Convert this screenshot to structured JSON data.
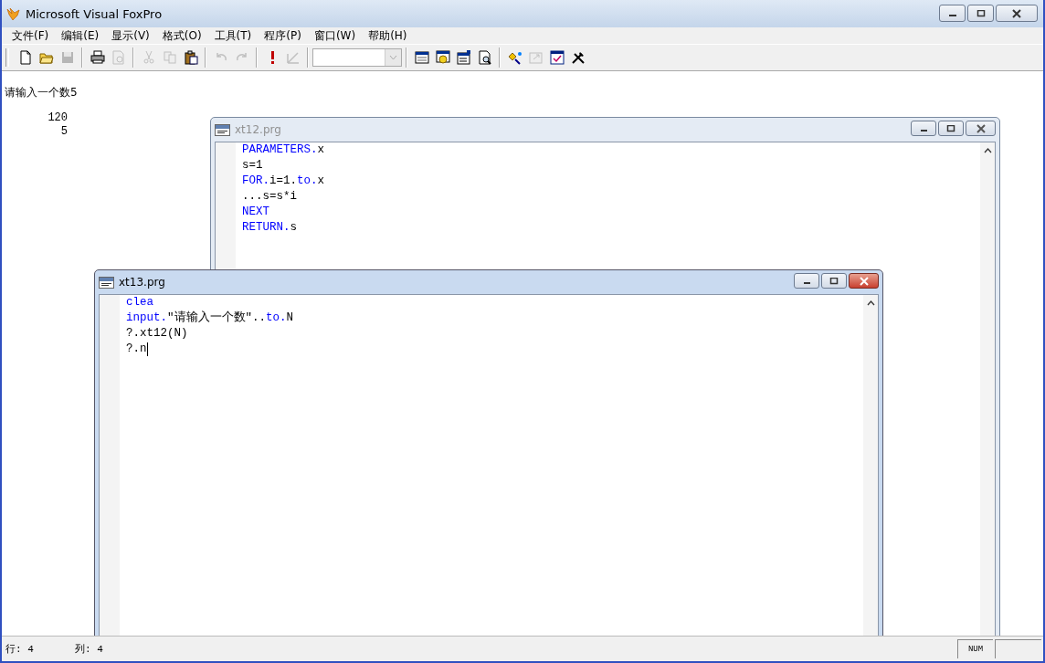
{
  "window": {
    "title": "Microsoft Visual FoxPro"
  },
  "menu": [
    {
      "label": "文件(F)"
    },
    {
      "label": "编辑(E)"
    },
    {
      "label": "显示(V)"
    },
    {
      "label": "格式(O)"
    },
    {
      "label": "工具(T)"
    },
    {
      "label": "程序(P)"
    },
    {
      "label": "窗口(W)"
    },
    {
      "label": "帮助(H)"
    }
  ],
  "toolbar": [
    [
      {
        "kind": "new",
        "disabled": false
      },
      {
        "kind": "open",
        "disabled": false
      },
      {
        "kind": "save",
        "disabled": true
      }
    ],
    [
      {
        "kind": "print",
        "disabled": false
      },
      {
        "kind": "preview",
        "disabled": true
      }
    ],
    [
      {
        "kind": "cut",
        "disabled": true
      },
      {
        "kind": "copy",
        "disabled": true
      },
      {
        "kind": "paste",
        "disabled": false
      }
    ],
    [
      {
        "kind": "undo",
        "disabled": true
      },
      {
        "kind": "redo",
        "disabled": true
      }
    ],
    [
      {
        "kind": "run",
        "disabled": false
      },
      {
        "kind": "modify",
        "disabled": true
      }
    ],
    [
      {
        "kind": "combo",
        "disabled": true
      }
    ],
    [
      {
        "kind": "command",
        "disabled": false
      },
      {
        "kind": "data",
        "disabled": false
      },
      {
        "kind": "properties",
        "disabled": false
      },
      {
        "kind": "find",
        "disabled": false
      }
    ],
    [
      {
        "kind": "wizard",
        "disabled": false
      },
      {
        "kind": "builder",
        "disabled": true
      },
      {
        "kind": "form",
        "disabled": false
      },
      {
        "kind": "tools",
        "disabled": false
      }
    ]
  ],
  "output": [
    {
      "text": "请输入一个数5",
      "kind": "prompt"
    },
    {
      "text": "120",
      "kind": "number"
    },
    {
      "text": "5",
      "kind": "number"
    }
  ],
  "editors": [
    {
      "title": "xt12.prg",
      "active": false,
      "lines": [
        [
          {
            "text": "PARAMETERS.",
            "kind": "keyword"
          },
          {
            "text": "x",
            "kind": "plain"
          }
        ],
        [
          {
            "text": "s=1",
            "kind": "plain"
          }
        ],
        [
          {
            "text": "FOR.",
            "kind": "keyword"
          },
          {
            "text": "i=1.",
            "kind": "plain"
          },
          {
            "text": "to.",
            "kind": "keyword"
          },
          {
            "text": "x",
            "kind": "plain"
          }
        ],
        [
          {
            "text": "...s=s*i",
            "kind": "plain"
          }
        ],
        [
          {
            "text": "NEXT",
            "kind": "keyword"
          }
        ],
        [
          {
            "text": "RETURN.",
            "kind": "keyword"
          },
          {
            "text": "s",
            "kind": "plain"
          }
        ]
      ]
    },
    {
      "title": "xt13.prg",
      "active": true,
      "lines": [
        [
          {
            "text": "clea",
            "kind": "keyword"
          }
        ],
        [
          {
            "text": "input.",
            "kind": "keyword"
          },
          {
            "text": "\"请输入一个数\"..",
            "kind": "plain"
          },
          {
            "text": "to.",
            "kind": "keyword"
          },
          {
            "text": "N",
            "kind": "plain"
          }
        ],
        [
          {
            "text": "?.xt12(N)",
            "kind": "plain"
          }
        ],
        [
          {
            "text": "?.n",
            "kind": "plain",
            "caret": true
          }
        ]
      ]
    }
  ],
  "status_bar": {
    "row": "行: 4",
    "column": "列: 4",
    "num": "NUM"
  }
}
